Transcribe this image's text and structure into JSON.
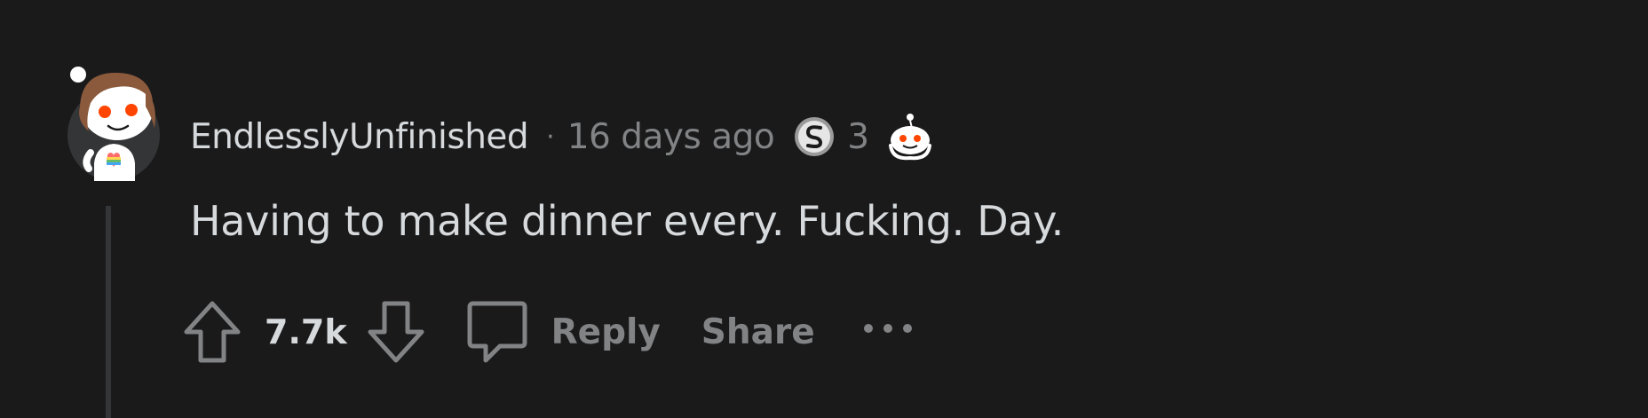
{
  "comment": {
    "author": "EndlesslyUnfinished",
    "separator": "·",
    "time_ago": "16 days ago",
    "award_count": "3",
    "body": "Having to make dinner every. Fucking. Day.",
    "score": "7.7k",
    "reply_label": "Reply",
    "share_label": "Share"
  },
  "icons": {
    "avatar": "snoo-avatar-icon",
    "silver_award": "silver-award-icon",
    "wholesome_award": "snoo-award-icon",
    "upvote": "upvote-arrow-icon",
    "downvote": "downvote-arrow-icon",
    "reply": "speech-bubble-icon",
    "more": "more-options-icon"
  },
  "colors": {
    "background": "#1a1a1b",
    "text_primary": "#d7dadc",
    "text_secondary": "#818384",
    "thread_line": "#343536",
    "snoo_eye": "#ff4500"
  }
}
